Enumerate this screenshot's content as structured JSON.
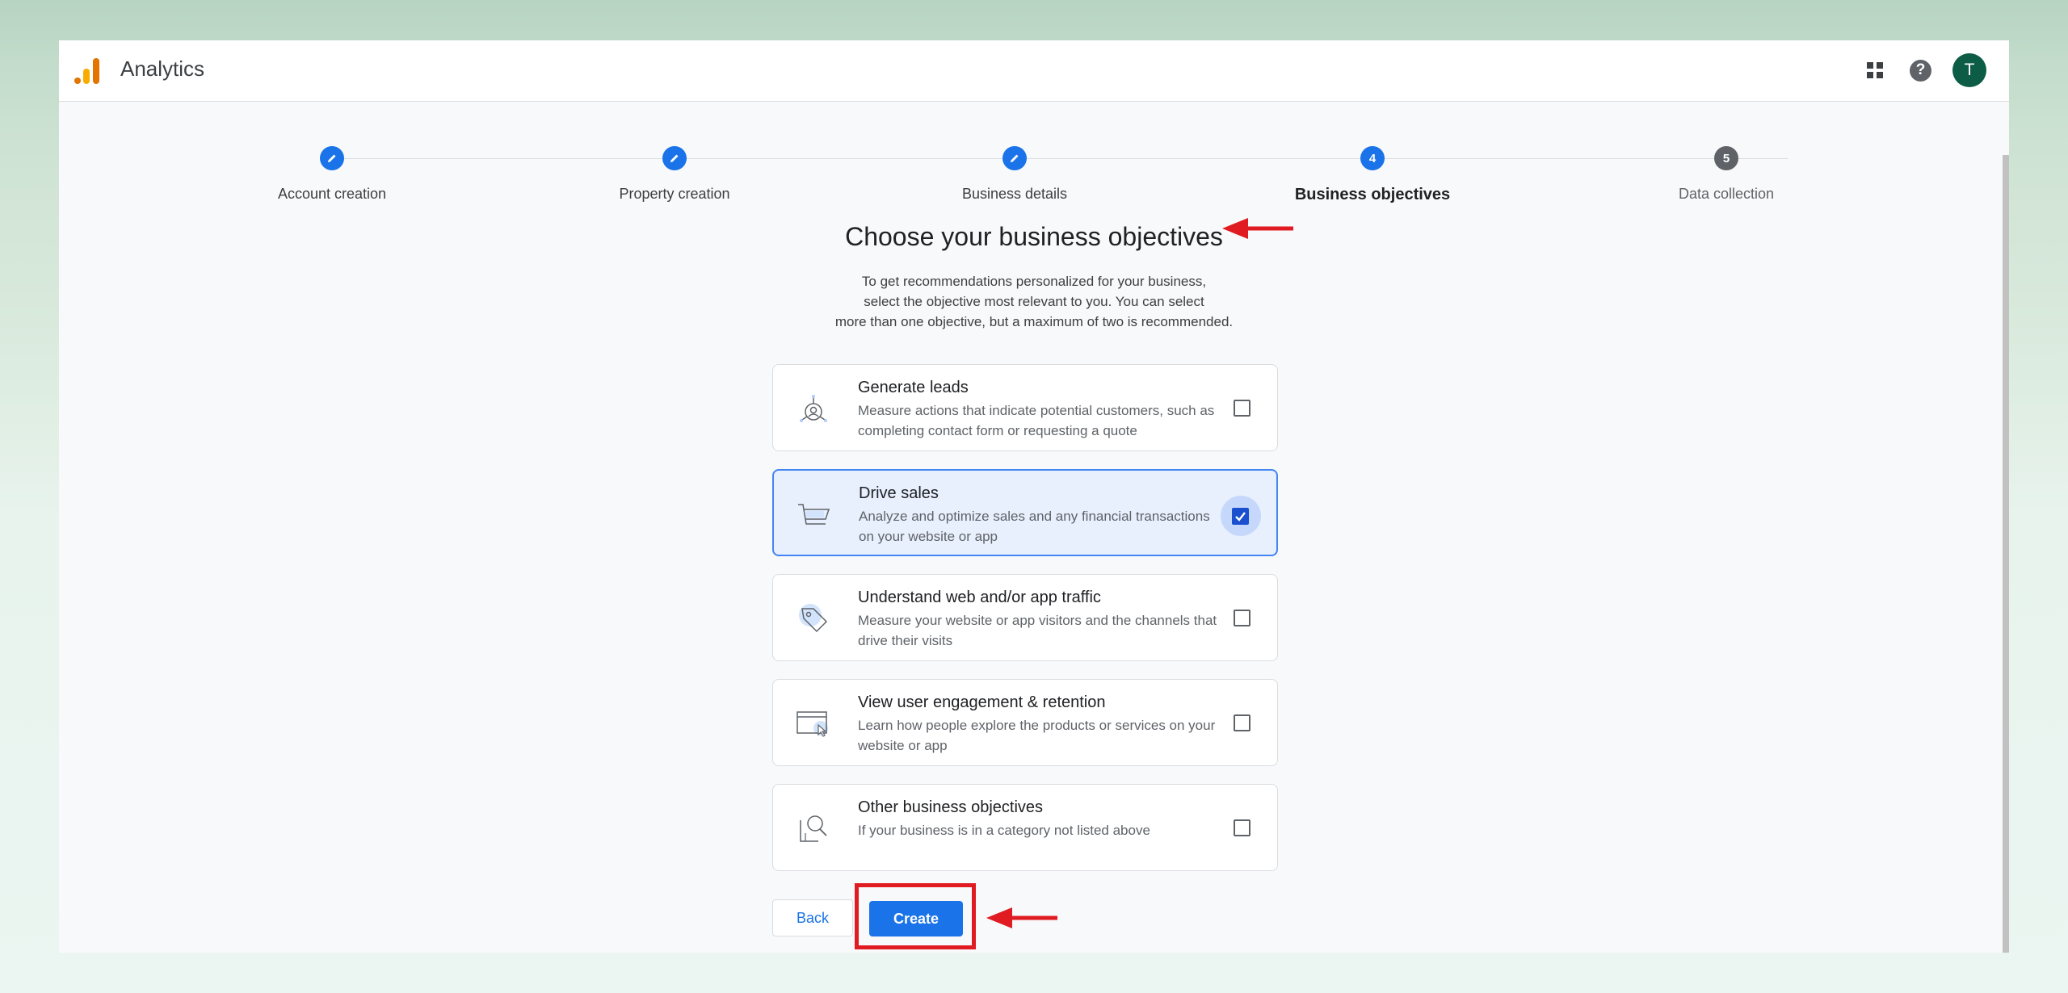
{
  "header": {
    "app_title": "Analytics",
    "icons": [
      "apps-grid-icon",
      "help-icon"
    ],
    "avatar_letter": "T"
  },
  "stepper": {
    "steps": [
      {
        "label": "Account creation",
        "state": "done",
        "number": ""
      },
      {
        "label": "Property creation",
        "state": "done",
        "number": ""
      },
      {
        "label": "Business details",
        "state": "done",
        "number": ""
      },
      {
        "label": "Business objectives",
        "state": "active",
        "number": "4"
      },
      {
        "label": "Data collection",
        "state": "todo",
        "number": "5"
      }
    ]
  },
  "main": {
    "heading": "Choose your business objectives",
    "subtext_lines": [
      "To get recommendations personalized for your business,",
      "select the objective most relevant to you. You can select",
      "more than one objective, but a maximum of two is recommended."
    ],
    "objectives": [
      {
        "title": "Generate leads",
        "desc": "Measure actions that indicate potential customers, such as completing contact form or requesting a quote",
        "checked": false,
        "icon": "leads-target-icon"
      },
      {
        "title": "Drive sales",
        "desc": "Analyze and optimize sales and any financial transactions on your website or app",
        "checked": true,
        "icon": "shopping-cart-icon"
      },
      {
        "title": "Understand web and/or app traffic",
        "desc": "Measure your website or app visitors and the channels that drive their visits",
        "checked": false,
        "icon": "tag-icon"
      },
      {
        "title": "View user engagement & retention",
        "desc": "Learn how people explore the products or services on your website or app",
        "checked": false,
        "icon": "browser-cursor-icon"
      },
      {
        "title": "Other business objectives",
        "desc": "If your business is in a category not listed above",
        "checked": false,
        "icon": "magnifier-document-icon"
      }
    ]
  },
  "actions": {
    "back_label": "Back",
    "create_label": "Create"
  },
  "colors": {
    "accent": "#1a73e8",
    "annotation_red": "#e01b22",
    "selected_bg": "#e8f0fe"
  }
}
